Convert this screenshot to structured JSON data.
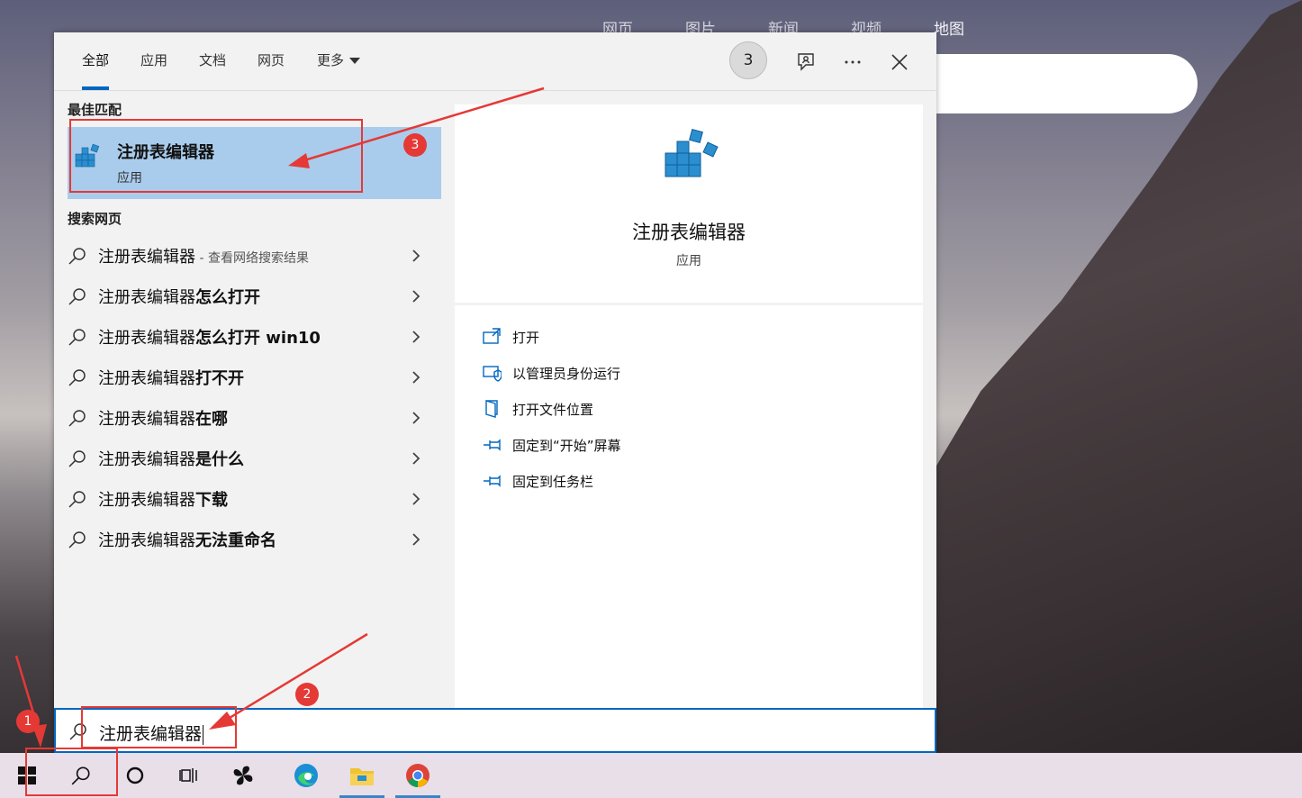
{
  "browser": {
    "tabs": [
      "网页",
      "图片",
      "新闻",
      "视频",
      "地图"
    ]
  },
  "search_panel": {
    "tabs": [
      {
        "label": "全部",
        "active": true
      },
      {
        "label": "应用",
        "active": false
      },
      {
        "label": "文档",
        "active": false
      },
      {
        "label": "网页",
        "active": false
      },
      {
        "label": "更多",
        "active": false
      }
    ],
    "reward_count": "3",
    "best_match": {
      "section_title": "最佳匹配",
      "name": "注册表编辑器",
      "type": "应用"
    },
    "web": {
      "section_title": "搜索网页",
      "items": [
        {
          "prefix": "注册表编辑器",
          "suffix": "",
          "note": " - 查看网络搜索结果"
        },
        {
          "prefix": "注册表编辑器",
          "suffix": "怎么打开",
          "note": ""
        },
        {
          "prefix": "注册表编辑器",
          "suffix": "怎么打开 win10",
          "note": ""
        },
        {
          "prefix": "注册表编辑器",
          "suffix": "打不开",
          "note": ""
        },
        {
          "prefix": "注册表编辑器",
          "suffix": "在哪",
          "note": ""
        },
        {
          "prefix": "注册表编辑器",
          "suffix": "是什么",
          "note": ""
        },
        {
          "prefix": "注册表编辑器",
          "suffix": "下载",
          "note": ""
        },
        {
          "prefix": "注册表编辑器",
          "suffix": "无法重命名",
          "note": ""
        }
      ]
    },
    "detail": {
      "name": "注册表编辑器",
      "type": "应用",
      "actions": [
        {
          "label": "打开",
          "icon": "open-icon"
        },
        {
          "label": "以管理员身份运行",
          "icon": "shield-admin-icon"
        },
        {
          "label": "打开文件位置",
          "icon": "file-location-icon"
        },
        {
          "label": "固定到“开始”屏幕",
          "icon": "pin-icon"
        },
        {
          "label": "固定到任务栏",
          "icon": "pin-icon"
        }
      ]
    },
    "query": "注册表编辑器"
  },
  "annotations": [
    "1",
    "2",
    "3"
  ],
  "colors": {
    "accent": "#0067c0",
    "highlight": "#a9ccec",
    "annotation": "#e53935"
  }
}
